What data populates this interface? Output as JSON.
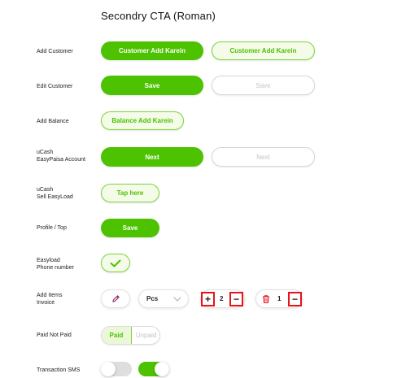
{
  "title": "Secondry CTA  (Roman)",
  "rows": {
    "add_customer": {
      "label": "Add Customer",
      "primary": "Customer Add Karein",
      "secondary": "Customer Add Karein"
    },
    "edit_customer": {
      "label": "Edit Customer",
      "primary": "Save",
      "secondary": "Save"
    },
    "add_balance": {
      "label": "Add Balance",
      "button": "Balance Add Karein"
    },
    "ucash_easypaisa": {
      "label_line1": "uCash",
      "label_line2": "EasyPaisa Account",
      "primary": "Next",
      "secondary": "Next"
    },
    "ucash_easyload": {
      "label_line1": "uCash",
      "label_line2": "Sell EasyLoad",
      "button": "Tap here"
    },
    "profile_top": {
      "label": "Profile / Top",
      "button": "Save"
    },
    "easyload_phone": {
      "label_line1": "Easyload",
      "label_line2": "Phone number",
      "icon": "check-icon"
    },
    "add_items_invoice": {
      "label_line1": "Add Items",
      "label_line2": "Invoice",
      "edit_icon": "pencil-icon",
      "unit_select": {
        "value": "Pcs",
        "icon": "chevron-down-icon"
      },
      "stepper": {
        "plus": "+",
        "value": "2",
        "minus": "−"
      },
      "delete_stepper": {
        "icon": "trash-icon",
        "value": "1",
        "minus": "−"
      }
    },
    "paid_not_paid": {
      "label": "Paid Not Paid",
      "options": [
        "Paid",
        "Unpaid"
      ],
      "selected": "Paid"
    },
    "transaction_sms": {
      "label": "Transaction SMS",
      "toggles": [
        {
          "state": "off"
        },
        {
          "state": "on"
        }
      ]
    }
  },
  "colors": {
    "accent": "#4cc200",
    "accent_light": "#f4fbe8",
    "highlight": "#e8121a",
    "disabled": "#c4c4c4"
  }
}
